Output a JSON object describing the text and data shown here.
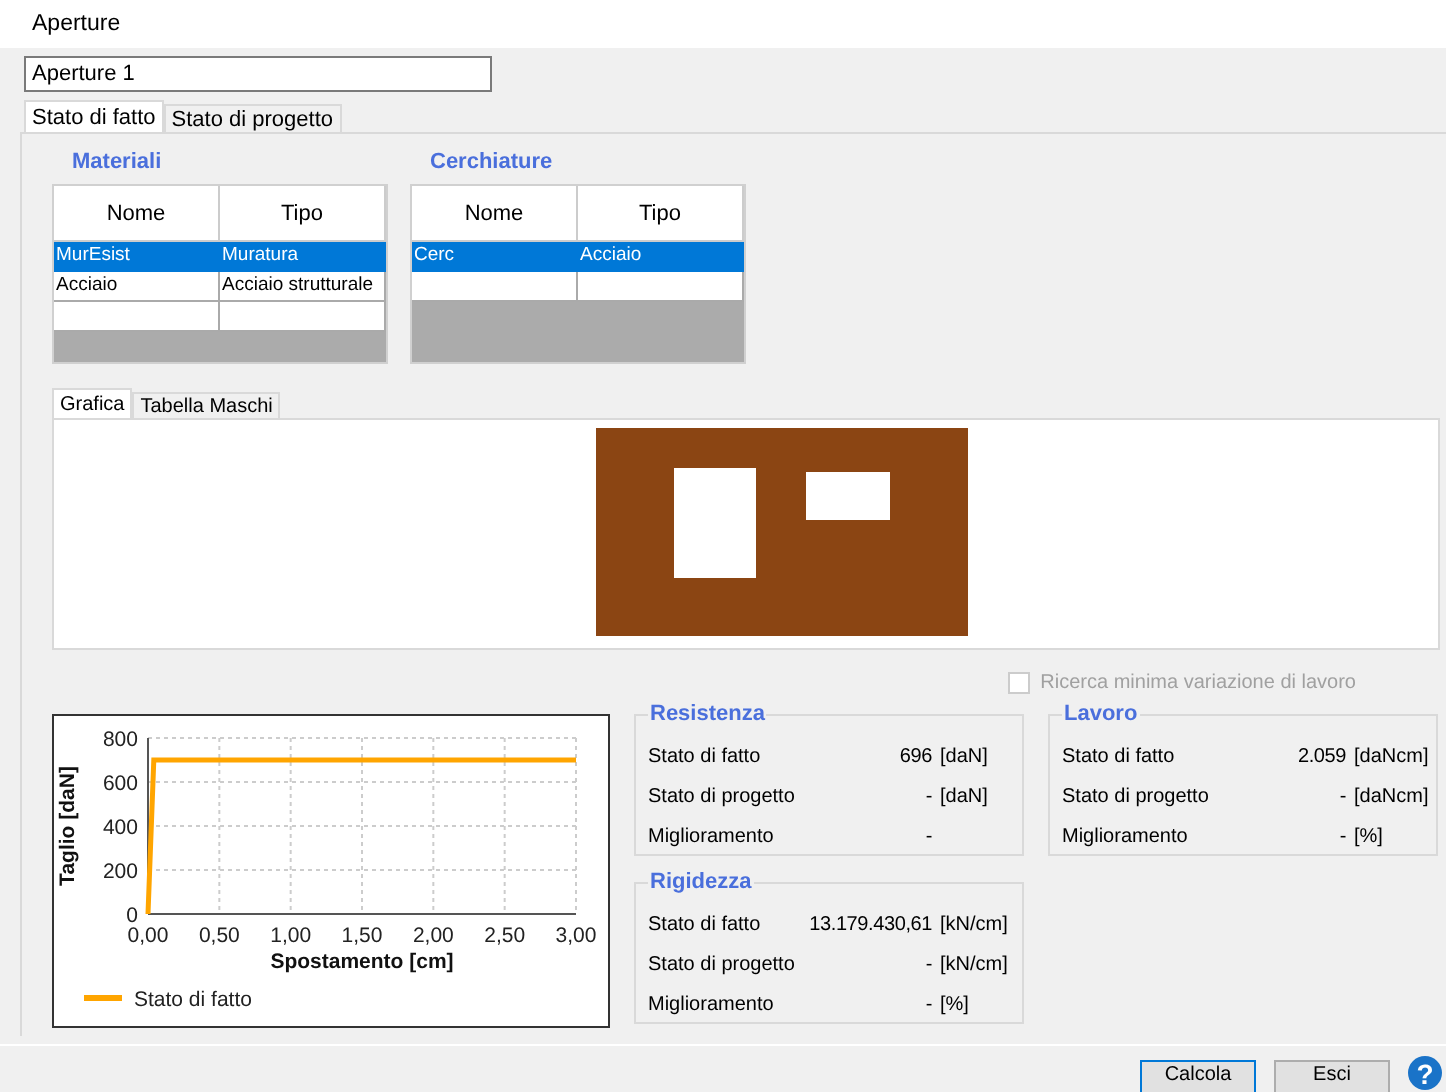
{
  "window": {
    "title": "Aperture"
  },
  "name_field": {
    "value": "Aperture 1"
  },
  "tabs": [
    {
      "label": "Stato di fatto",
      "selected": true
    },
    {
      "label": "Stato di progetto",
      "selected": false
    }
  ],
  "materiali": {
    "title": "Materiali",
    "columns": [
      "Nome",
      "Tipo"
    ],
    "rows": [
      {
        "cells": [
          "MurEsist",
          "Muratura"
        ],
        "selected": true
      },
      {
        "cells": [
          "Acciaio",
          "Acciaio strutturale"
        ],
        "selected": false
      },
      {
        "cells": [
          "",
          ""
        ],
        "selected": false
      }
    ]
  },
  "cerchiature": {
    "title": "Cerchiature",
    "columns": [
      "Nome",
      "Tipo"
    ],
    "rows": [
      {
        "cells": [
          "Cerc",
          "Acciaio"
        ],
        "selected": true
      },
      {
        "cells": [
          "",
          ""
        ],
        "selected": false
      }
    ]
  },
  "inner_tabs": [
    {
      "label": "Grafica",
      "selected": true
    },
    {
      "label": "Tabella Maschi",
      "selected": false
    }
  ],
  "option": {
    "label": "Ricerca minima variazione di lavoro",
    "checked": false,
    "disabled": true
  },
  "chart": {
    "chart_data": {
      "type": "line",
      "grid": true,
      "xlabel": "Spostamento [cm]",
      "ylabel": "Taglio [daN]",
      "x": [
        0,
        0.04,
        3.0
      ],
      "series": [
        {
          "name": "Stato di fatto",
          "color": "#ffa500",
          "values": [
            0,
            700,
            700
          ]
        }
      ],
      "xlim": [
        0,
        3
      ],
      "ylim": [
        0,
        800
      ],
      "xticks": [
        {
          "value": 0,
          "label": "0,00"
        },
        {
          "value": 0.5,
          "label": "0,50"
        },
        {
          "value": 1,
          "label": "1,00"
        },
        {
          "value": 1.5,
          "label": "1,50"
        },
        {
          "value": 2,
          "label": "2,00"
        },
        {
          "value": 2.5,
          "label": "2,50"
        },
        {
          "value": 3,
          "label": "3,00"
        }
      ],
      "yticks": [
        0,
        200,
        400,
        600,
        800
      ]
    }
  },
  "groups": [
    {
      "title": "Resistenza",
      "rows": [
        {
          "label": "Stato di fatto",
          "value": "696",
          "unit": "[daN]"
        },
        {
          "label": "Stato di progetto",
          "value": "-",
          "unit": "[daN]"
        },
        {
          "label": "Miglioramento",
          "value": "-",
          "unit": ""
        }
      ]
    },
    {
      "title": "Lavoro",
      "rows": [
        {
          "label": "Stato di fatto",
          "value": "2.059",
          "unit": "[daNcm]"
        },
        {
          "label": "Stato di progetto",
          "value": "-",
          "unit": "[daNcm]"
        },
        {
          "label": "Miglioramento",
          "value": "-",
          "unit": "[%]"
        }
      ]
    },
    {
      "title": "Rigidezza",
      "rows": [
        {
          "label": "Stato di fatto",
          "value": "13.179.430,61",
          "unit": "[kN/cm]"
        },
        {
          "label": "Stato di progetto",
          "value": "-",
          "unit": "[kN/cm]"
        },
        {
          "label": "Miglioramento",
          "value": "-",
          "unit": "[%]"
        }
      ]
    }
  ],
  "buttons": [
    {
      "label": "Calcola",
      "selected": true
    },
    {
      "label": "Esci",
      "selected": false
    }
  ],
  "help": {
    "label": "?"
  }
}
